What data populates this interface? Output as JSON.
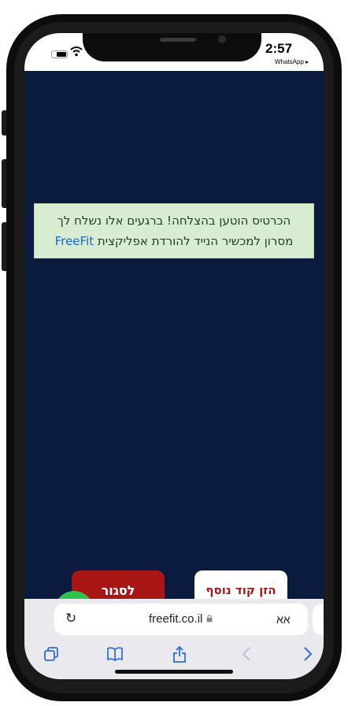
{
  "status_bar": {
    "time": "2:57",
    "back_to_app": "WhatsApp ▸"
  },
  "message": {
    "line1": "הכרטיס הוטען בהצלחה! ברגעים אלו נשלח לך",
    "line2_prefix": "מסרון למכשיר הנייד להורדת אפליקצית ",
    "brand": "FreeFit"
  },
  "buttons": {
    "close_label": "לסגור",
    "enter_code_label": "הזן קוד נוסף"
  },
  "browser": {
    "url": "freefit.co.il",
    "text_size_label": "אא"
  },
  "icons": {
    "reload": "↻",
    "lock": "🔒",
    "tabs": "⧉",
    "bookmarks": "📖",
    "share": "⇪",
    "back": "‹",
    "forward": "›",
    "wifi": "◠",
    "accessibility": "♿"
  },
  "colors": {
    "page_background": "#0b1b3f",
    "alert_background": "#d8ecd2",
    "close_button": "#a81616",
    "whatsapp": "#2fc24c",
    "browser_blue": "#2f6bd6"
  }
}
